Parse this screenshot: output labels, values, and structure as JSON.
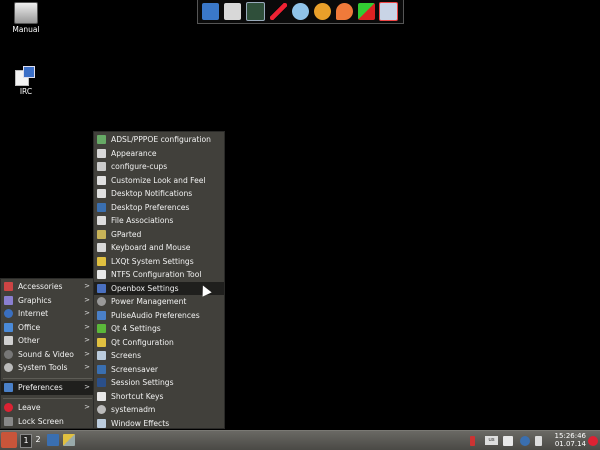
{
  "desktop": {
    "icons": [
      {
        "label": "Manual",
        "icon": "manual-icon"
      },
      {
        "label": "IRC",
        "icon": "irc-icon"
      }
    ]
  },
  "dock": {
    "icons": [
      "task-manager-icon",
      "notepad-icon",
      "terminal-icon",
      "pen-icon",
      "browser-icon",
      "xchat-icon",
      "melon-icon",
      "network-icon",
      "media-icon"
    ]
  },
  "main_menu": {
    "items": [
      {
        "label": "Accessories",
        "submenu": ">"
      },
      {
        "label": "Graphics",
        "submenu": ">"
      },
      {
        "label": "Internet",
        "submenu": ">"
      },
      {
        "label": "Office",
        "submenu": ">"
      },
      {
        "label": "Other",
        "submenu": ">"
      },
      {
        "label": "Sound & Video",
        "submenu": ">"
      },
      {
        "label": "System Tools",
        "submenu": ">"
      },
      {
        "label": "Preferences",
        "submenu": ">"
      },
      {
        "label": "Leave",
        "submenu": ">"
      },
      {
        "label": "Lock Screen",
        "submenu": ""
      }
    ]
  },
  "sub_menu": {
    "items": [
      {
        "label": "ADSL/PPPOE configuration"
      },
      {
        "label": "Appearance"
      },
      {
        "label": "configure-cups"
      },
      {
        "label": "Customize Look and Feel"
      },
      {
        "label": "Desktop Notifications"
      },
      {
        "label": "Desktop Preferences"
      },
      {
        "label": "File Associations"
      },
      {
        "label": "GParted"
      },
      {
        "label": "Keyboard and Mouse"
      },
      {
        "label": "LXQt System Settings"
      },
      {
        "label": "NTFS Configuration Tool"
      },
      {
        "label": "Openbox Settings"
      },
      {
        "label": "Power Management"
      },
      {
        "label": "PulseAudio Preferences"
      },
      {
        "label": "Qt 4 Settings"
      },
      {
        "label": "Qt Configuration"
      },
      {
        "label": "Screens"
      },
      {
        "label": "Screensaver"
      },
      {
        "label": "Session Settings"
      },
      {
        "label": "Shortcut Keys"
      },
      {
        "label": "systemadm"
      },
      {
        "label": "Window Effects"
      }
    ]
  },
  "taskbar": {
    "desktops": [
      "1",
      "2"
    ],
    "keyboard_layout": "us",
    "time": "15:26:46",
    "date": "01.07.14"
  }
}
